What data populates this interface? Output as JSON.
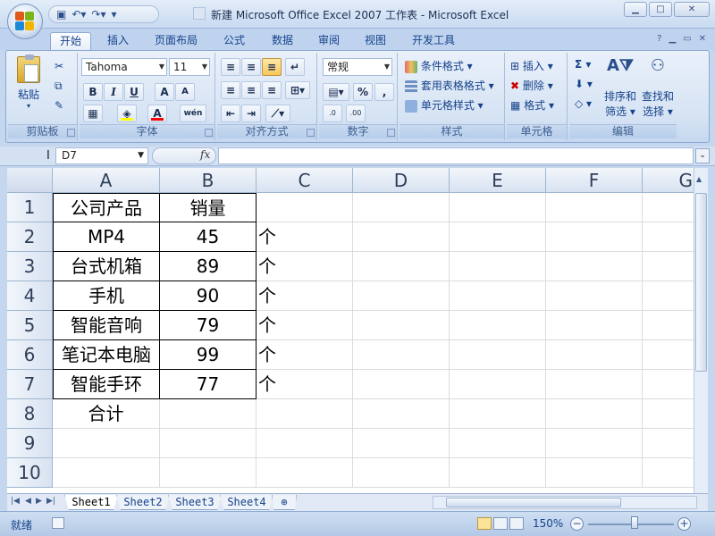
{
  "window": {
    "title": "新建 Microsoft Office Excel 2007 工作表 - Microsoft Excel"
  },
  "qat": {
    "items": [
      "save-icon",
      "undo-icon",
      "redo-icon",
      "customize-icon"
    ]
  },
  "ribbon": {
    "tabs": [
      "开始",
      "插入",
      "页面布局",
      "公式",
      "数据",
      "审阅",
      "视图",
      "开发工具"
    ],
    "active_tab": "开始",
    "groups": {
      "clipboard": {
        "label": "剪贴板",
        "paste": "粘贴"
      },
      "font": {
        "label": "字体",
        "font_name": "Tahoma",
        "font_size": "11",
        "bold": "B",
        "italic": "I",
        "underline": "U",
        "grow": "A",
        "shrink": "A",
        "fill_color": "#ffff00",
        "font_color": "#ff0000"
      },
      "alignment": {
        "label": "对齐方式"
      },
      "number": {
        "label": "数字",
        "format": "常规",
        "percent": "%",
        "comma": ",",
        "inc_dec": ".0 .00",
        "dec_dec": ".00 .0"
      },
      "styles": {
        "label": "样式",
        "conditional": "条件格式",
        "table_format": "套用表格格式",
        "cell_style": "单元格样式"
      },
      "cells": {
        "label": "单元格",
        "insert": "插入",
        "delete": "删除",
        "format": "格式"
      },
      "editing": {
        "label": "编辑",
        "sort_filter_1": "排序和",
        "sort_filter_2": "筛选",
        "find_select_1": "查找和",
        "find_select_2": "选择",
        "sigma": "Σ"
      }
    }
  },
  "formula_bar": {
    "name_box": "D7",
    "fx": "fx",
    "content": ""
  },
  "sheet": {
    "columns": [
      "A",
      "B",
      "C",
      "D",
      "E",
      "F",
      "G"
    ],
    "rows": [
      "1",
      "2",
      "3",
      "4",
      "5",
      "6",
      "7",
      "8",
      "9",
      "10"
    ],
    "data": [
      [
        "公司产品",
        "销量",
        ""
      ],
      [
        "MP4",
        "45",
        "个"
      ],
      [
        "台式机箱",
        "89",
        "个"
      ],
      [
        "手机",
        "90",
        "个"
      ],
      [
        "智能音响",
        "79",
        "个"
      ],
      [
        "笔记本电脑",
        "99",
        "个"
      ],
      [
        "智能手环",
        "77",
        "个"
      ],
      [
        "合计",
        "",
        ""
      ],
      [
        "",
        "",
        ""
      ],
      [
        "",
        "",
        ""
      ]
    ]
  },
  "sheet_tabs": [
    "Sheet1",
    "Sheet2",
    "Sheet3",
    "Sheet4"
  ],
  "active_sheet": "Sheet1",
  "status": {
    "text": "就绪",
    "zoom": "150%"
  }
}
